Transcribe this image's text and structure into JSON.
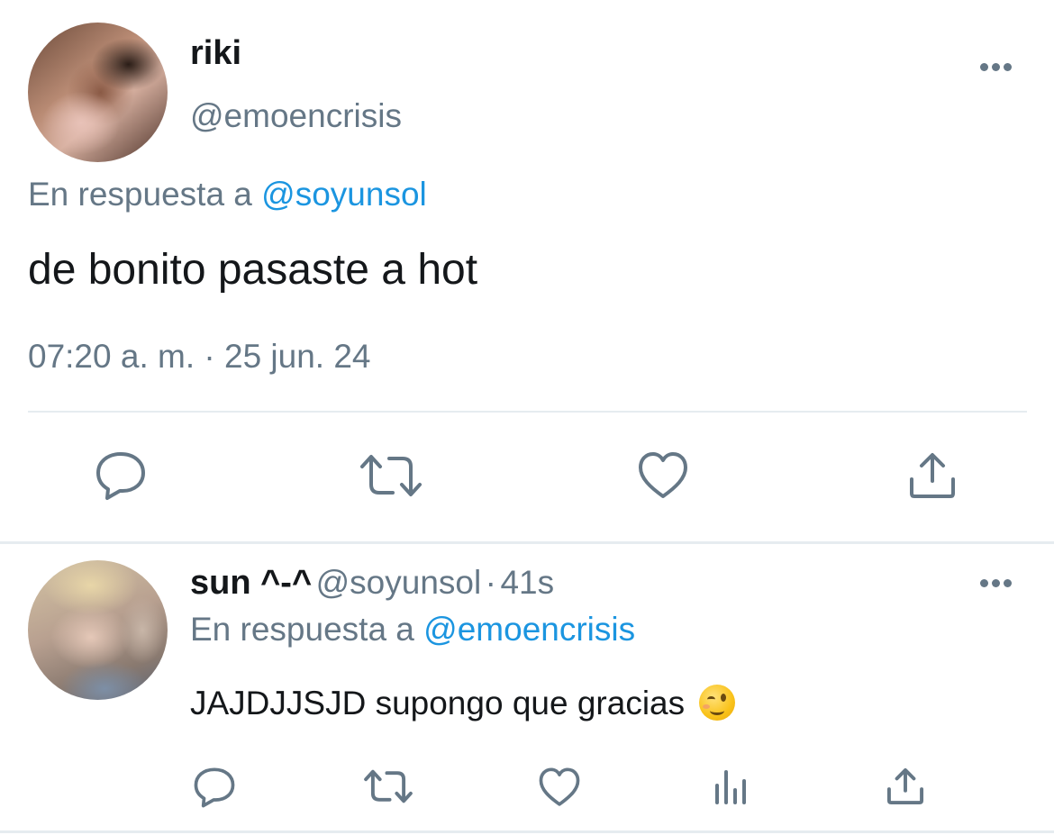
{
  "main_tweet": {
    "display_name": "riki",
    "handle": "@emoencrisis",
    "replying_prefix": "En respuesta a",
    "replying_to": "@soyunsol",
    "text": "de bonito pasaste a hot",
    "timestamp": "07:20 a. m. · 25 jun. 24",
    "actions": {
      "reply_icon": "reply-icon",
      "retweet_icon": "retweet-icon",
      "like_icon": "heart-icon",
      "share_icon": "share-icon"
    },
    "more_icon": "more-horizontal-icon"
  },
  "reply_tweet": {
    "display_name": "sun ^-^",
    "handle": "@soyunsol",
    "separator": "·",
    "time_ago": "41s",
    "replying_prefix": "En respuesta a",
    "replying_to": "@emoencrisis",
    "text": "JAJDJJSJD supongo que gracias",
    "emoji": "winking-face",
    "actions": {
      "reply_icon": "reply-icon",
      "retweet_icon": "retweet-icon",
      "like_icon": "heart-icon",
      "stats_icon": "analytics-icon",
      "share_icon": "share-icon"
    },
    "more_icon": "more-horizontal-icon"
  },
  "colors": {
    "text_primary": "#14171a",
    "text_secondary": "#657786",
    "link": "#1b95e0",
    "divider": "#e6ecf0"
  }
}
